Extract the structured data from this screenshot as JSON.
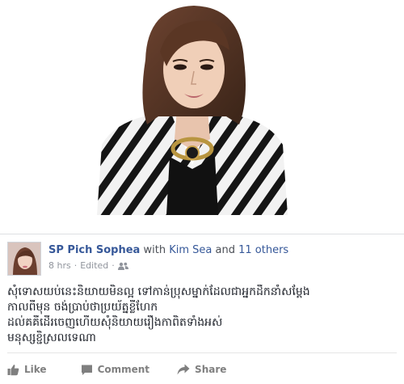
{
  "post": {
    "author": "SP Pich Sophea",
    "with_word": "with",
    "tagged_person": "Kim Sea",
    "and_word": "and",
    "others": "11 others",
    "time": "8 hrs",
    "dot": "·",
    "edited": "Edited",
    "text_lines": [
      "សុំទោសយប់នេះនិយាយមិនល្អ ទៅកាន់ប្រុសម្នាក់ដែលជាអ្នកដឹកនាំសម្ដែង",
      "កាលពីមុន ចង់ប្រាប់ថាប្រយ័ត្នខ្លីហែក",
      "ដល់គគីដើរចេញហើយសុំនិយាយរឿងកាពិតទាំងអស់",
      "មនុស្សខ្ជិស្រលទេណា"
    ]
  },
  "actions": {
    "like": "Like",
    "comment": "Comment",
    "share": "Share"
  },
  "icons": {
    "audience": "friends-icon",
    "like": "thumbs-up-icon",
    "comment": "comment-icon",
    "share": "share-arrow-icon"
  },
  "colors": {
    "link": "#365899",
    "meta": "#90949c",
    "action": "#7f7f7f"
  }
}
